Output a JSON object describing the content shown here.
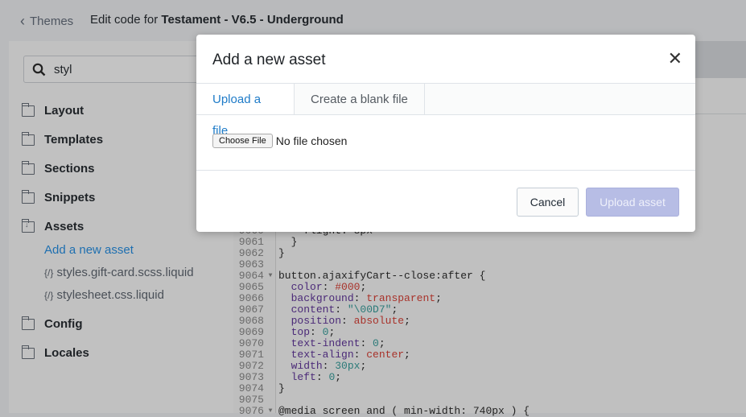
{
  "header": {
    "back_label": "Themes",
    "title_prefix": "Edit code for",
    "theme_name": "Testament - V6.5 - Underground"
  },
  "sidebar": {
    "search_value": "styl",
    "folders": [
      "Layout",
      "Templates",
      "Sections",
      "Snippets",
      "Assets",
      "Config",
      "Locales"
    ],
    "assets": {
      "add_label": "Add a new asset",
      "files": [
        "styles.gift-card.scss.liquid",
        "stylesheet.css.liquid"
      ],
      "file_icon": "{/}"
    }
  },
  "editor": {
    "lines": [
      {
        "n": "9060",
        "t": "    flight: 8px"
      },
      {
        "n": "9061",
        "t": "  }"
      },
      {
        "n": "9062",
        "t": "}"
      },
      {
        "n": "9063",
        "t": ""
      },
      {
        "n": "9064",
        "t": "button.ajaxifyCart--close:after {",
        "fold": true
      },
      {
        "n": "9065",
        "p": "color",
        "v": "#000"
      },
      {
        "n": "9066",
        "p": "background",
        "v": "transparent"
      },
      {
        "n": "9067",
        "p": "content",
        "v": "\"\\00D7\""
      },
      {
        "n": "9068",
        "p": "position",
        "v": "absolute"
      },
      {
        "n": "9069",
        "p": "top",
        "v": "0"
      },
      {
        "n": "9070",
        "p": "text-indent",
        "v": "0"
      },
      {
        "n": "9071",
        "p": "text-align",
        "v": "center"
      },
      {
        "n": "9072",
        "p": "width",
        "v": "30px"
      },
      {
        "n": "9073",
        "p": "left",
        "v": "0"
      },
      {
        "n": "9074",
        "t": "}"
      },
      {
        "n": "9075",
        "t": ""
      },
      {
        "n": "9076",
        "t": "@media screen and ( min-width: 740px ) {",
        "fold": true
      }
    ]
  },
  "modal": {
    "title": "Add a new asset",
    "tabs": [
      "Upload a file",
      "Create a blank file"
    ],
    "choose_file_label": "Choose File",
    "file_status": "No file chosen",
    "cancel_label": "Cancel",
    "upload_label": "Upload asset"
  }
}
